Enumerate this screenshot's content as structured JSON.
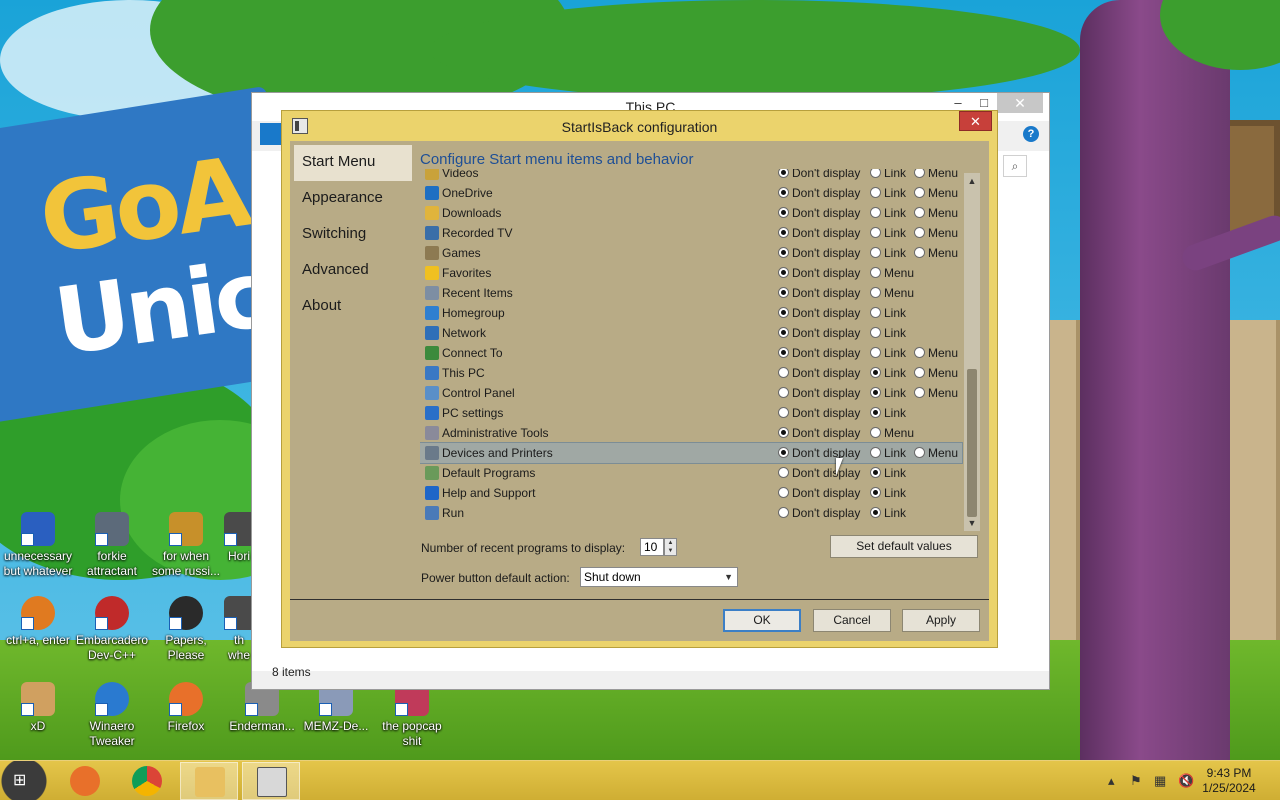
{
  "explorer": {
    "title": "This PC",
    "status": "8 items",
    "help_glyph": "?",
    "minimize_glyph": "–",
    "maximize_glyph": "□",
    "close_glyph": "✕"
  },
  "dialog": {
    "title": "StartIsBack configuration",
    "close_glyph": "✕",
    "nav": [
      "Start Menu",
      "Appearance",
      "Switching",
      "Advanced",
      "About"
    ],
    "section_title": "Configure Start menu items and behavior",
    "option_labels": {
      "dont": "Don't display",
      "link": "Link",
      "menu": "Menu"
    },
    "rows": [
      {
        "label": "Videos",
        "icon_color": "#c9a23a",
        "options": [
          "dont",
          "link",
          "menu"
        ],
        "selected": "dont"
      },
      {
        "label": "OneDrive",
        "icon_color": "#1f6fc2",
        "options": [
          "dont",
          "link",
          "menu"
        ],
        "selected": "dont"
      },
      {
        "label": "Downloads",
        "icon_color": "#e0b43c",
        "options": [
          "dont",
          "link",
          "menu"
        ],
        "selected": "dont"
      },
      {
        "label": "Recorded TV",
        "icon_color": "#3a6ea8",
        "options": [
          "dont",
          "link",
          "menu"
        ],
        "selected": "dont"
      },
      {
        "label": "Games",
        "icon_color": "#8d7a52",
        "options": [
          "dont",
          "link",
          "menu"
        ],
        "selected": "dont"
      },
      {
        "label": "Favorites",
        "icon_color": "#f0c020",
        "options": [
          "dont",
          "menu"
        ],
        "selected": "dont"
      },
      {
        "label": "Recent Items",
        "icon_color": "#7d8ea3",
        "options": [
          "dont",
          "menu"
        ],
        "selected": "dont"
      },
      {
        "label": "Homegroup",
        "icon_color": "#2f7fd0",
        "options": [
          "dont",
          "link"
        ],
        "selected": "dont"
      },
      {
        "label": "Network",
        "icon_color": "#2f6fb8",
        "options": [
          "dont",
          "link"
        ],
        "selected": "dont"
      },
      {
        "label": "Connect To",
        "icon_color": "#3c8a3c",
        "options": [
          "dont",
          "link",
          "menu"
        ],
        "selected": "dont"
      },
      {
        "label": "This PC",
        "icon_color": "#3a78c4",
        "options": [
          "dont",
          "link",
          "menu"
        ],
        "selected": "link"
      },
      {
        "label": "Control Panel",
        "icon_color": "#5a8fc8",
        "options": [
          "dont",
          "link",
          "menu"
        ],
        "selected": "link"
      },
      {
        "label": "PC settings",
        "icon_color": "#2a6fc8",
        "options": [
          "dont",
          "link"
        ],
        "selected": "link"
      },
      {
        "label": "Administrative Tools",
        "icon_color": "#8a8a9a",
        "options": [
          "dont",
          "menu"
        ],
        "selected": "dont"
      },
      {
        "label": "Devices and Printers",
        "icon_color": "#6a7a8a",
        "options": [
          "dont",
          "link",
          "menu"
        ],
        "selected": "dont",
        "highlighted": true
      },
      {
        "label": "Default Programs",
        "icon_color": "#6a9a5a",
        "options": [
          "dont",
          "link"
        ],
        "selected": "link"
      },
      {
        "label": "Help and Support",
        "icon_color": "#1f66c8",
        "options": [
          "dont",
          "link"
        ],
        "selected": "link"
      },
      {
        "label": "Run",
        "icon_color": "#4a7ab8",
        "options": [
          "dont",
          "link"
        ],
        "selected": "link"
      }
    ],
    "recent_label": "Number of recent programs to display:",
    "recent_value": "10",
    "power_label": "Power button default action:",
    "power_value": "Shut down",
    "set_default_label": "Set default values",
    "ok_label": "OK",
    "cancel_label": "Cancel",
    "apply_label": "Apply"
  },
  "desktop_icons": [
    {
      "label": "unnecessary but whatever",
      "color": "#2a5fc0"
    },
    {
      "label": "forkie attractant",
      "color": "#5c6a7a"
    },
    {
      "label": "for when some russi...",
      "color": "#c7902a"
    },
    {
      "label": "ctrl+a, enter",
      "color": "#e07a20"
    },
    {
      "label": "Embarcadero Dev-C++",
      "color": "#c02a2a"
    },
    {
      "label": "Papers, Please",
      "color": "#2a2a2a"
    },
    {
      "label": "xD",
      "color": "#d0a060"
    },
    {
      "label": "Winaero Tweaker",
      "color": "#2a7ad0"
    },
    {
      "label": "Firefox",
      "color": "#e8702a"
    },
    {
      "label": "Enderman...",
      "color": "#8a8a8a"
    },
    {
      "label": "MEMZ-De...",
      "color": "#8a9ab8"
    },
    {
      "label": "the popcap shit",
      "color": "#c03a5a"
    },
    {
      "label": "Hori",
      "color": "#4a4a4a"
    },
    {
      "label": "th whe",
      "color": "#4a4a4a"
    }
  ],
  "taskbar": {
    "start_glyph": "⊞",
    "apps": [
      {
        "name": "Firefox",
        "color": "#e8702a"
      },
      {
        "name": "Chrome",
        "color": "#3a9a3a"
      },
      {
        "name": "File Explorer",
        "color": "#e8c060"
      },
      {
        "name": "StartIsBack",
        "color": "#d8d8d8"
      }
    ],
    "time": "9:43 PM",
    "date": "1/25/2024"
  }
}
